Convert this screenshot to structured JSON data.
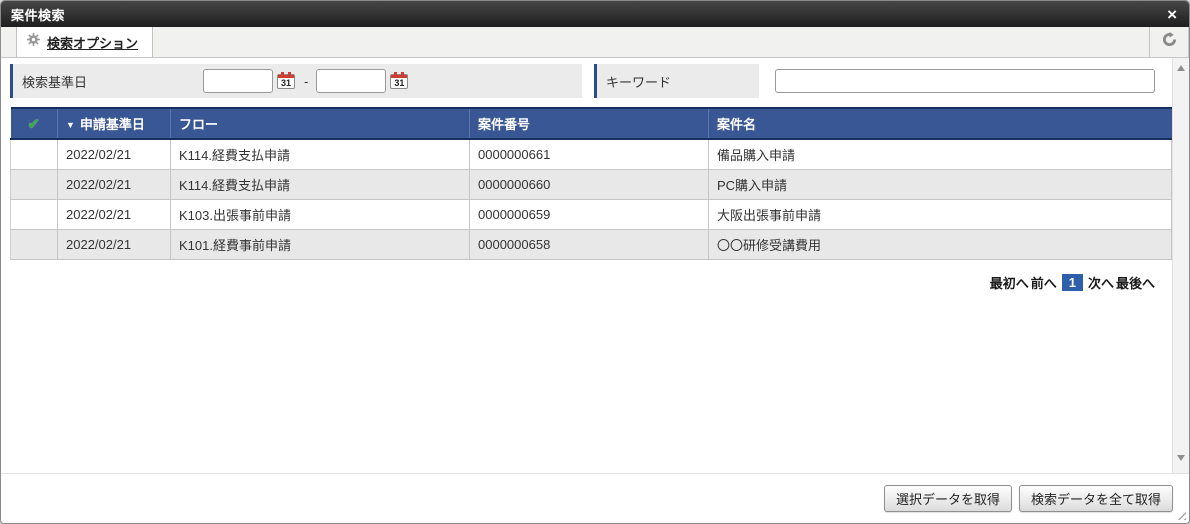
{
  "window": {
    "title": "案件検索",
    "close_glyph": "×"
  },
  "toolbar": {
    "tab_label": "検索オプション"
  },
  "filters": {
    "date_label": "検索基準日",
    "date_from_value": "",
    "date_to_value": "",
    "date_separator": "-",
    "calendar_day": "31",
    "keyword_label": "キーワード",
    "keyword_value": ""
  },
  "table": {
    "select_all_glyph": "✔",
    "sort_indicator": "▼",
    "columns": [
      "申請基準日",
      "フロー",
      "案件番号",
      "案件名"
    ],
    "rows": [
      {
        "date": "2022/02/21",
        "flow": "K114.経費支払申請",
        "case_no": "0000000661",
        "case_name": "備品購入申請"
      },
      {
        "date": "2022/02/21",
        "flow": "K114.経費支払申請",
        "case_no": "0000000660",
        "case_name": "PC購入申請"
      },
      {
        "date": "2022/02/21",
        "flow": "K103.出張事前申請",
        "case_no": "0000000659",
        "case_name": "大阪出張事前申請"
      },
      {
        "date": "2022/02/21",
        "flow": "K101.経費事前申請",
        "case_no": "0000000658",
        "case_name": "〇〇研修受講費用"
      }
    ]
  },
  "pagination": {
    "first": "最初へ",
    "prev": "前へ",
    "current_page": "1",
    "next": "次へ",
    "last": "最後へ"
  },
  "footer": {
    "get_selected_label": "選択データを取得",
    "get_all_label": "検索データを全て取得"
  },
  "colors": {
    "header_bg": "#3a5795",
    "accent_blue": "#2d5faa",
    "check_green": "#2fae3c",
    "calendar_red": "#d03c30",
    "titlebar_dark": "#1e1e1e"
  }
}
